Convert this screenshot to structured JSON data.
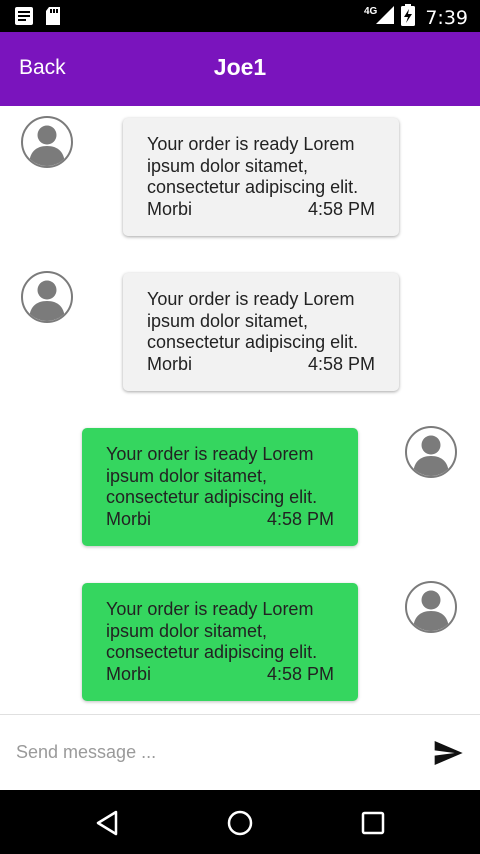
{
  "status_bar": {
    "network": "4G",
    "time": "7:39",
    "icons": [
      "notification-icon",
      "sd-card-icon",
      "signal-icon",
      "battery-charging-icon"
    ]
  },
  "header": {
    "back_label": "Back",
    "title": "Joe1",
    "background_color": "#7a14bd"
  },
  "messages": [
    {
      "direction": "incoming",
      "text": "Your order is ready Lorem ipsum dolor sitamet, consectetur adipiscing elit. Morbi",
      "time": "4:58 PM",
      "bubble_color": "#f2f2f2"
    },
    {
      "direction": "incoming",
      "text": "Your order is ready Lorem ipsum dolor sitamet, consectetur adipiscing elit. Morbi",
      "time": "4:58 PM",
      "bubble_color": "#f2f2f2"
    },
    {
      "direction": "outgoing",
      "text": "Your order is ready Lorem ipsum dolor sitamet, consectetur adipiscing elit. Morbi",
      "time": "4:58 PM",
      "bubble_color": "#35d65f"
    },
    {
      "direction": "outgoing",
      "text": "Your order is ready Lorem ipsum dolor sitamet, consectetur adipiscing elit. Morbi",
      "time": "4:58 PM",
      "bubble_color": "#35d65f"
    }
  ],
  "composer": {
    "placeholder": "Send message ...",
    "value": "",
    "send_icon": "send-icon"
  },
  "nav_bar": {
    "icons": [
      "back-triangle-icon",
      "home-circle-icon",
      "recents-square-icon"
    ]
  }
}
